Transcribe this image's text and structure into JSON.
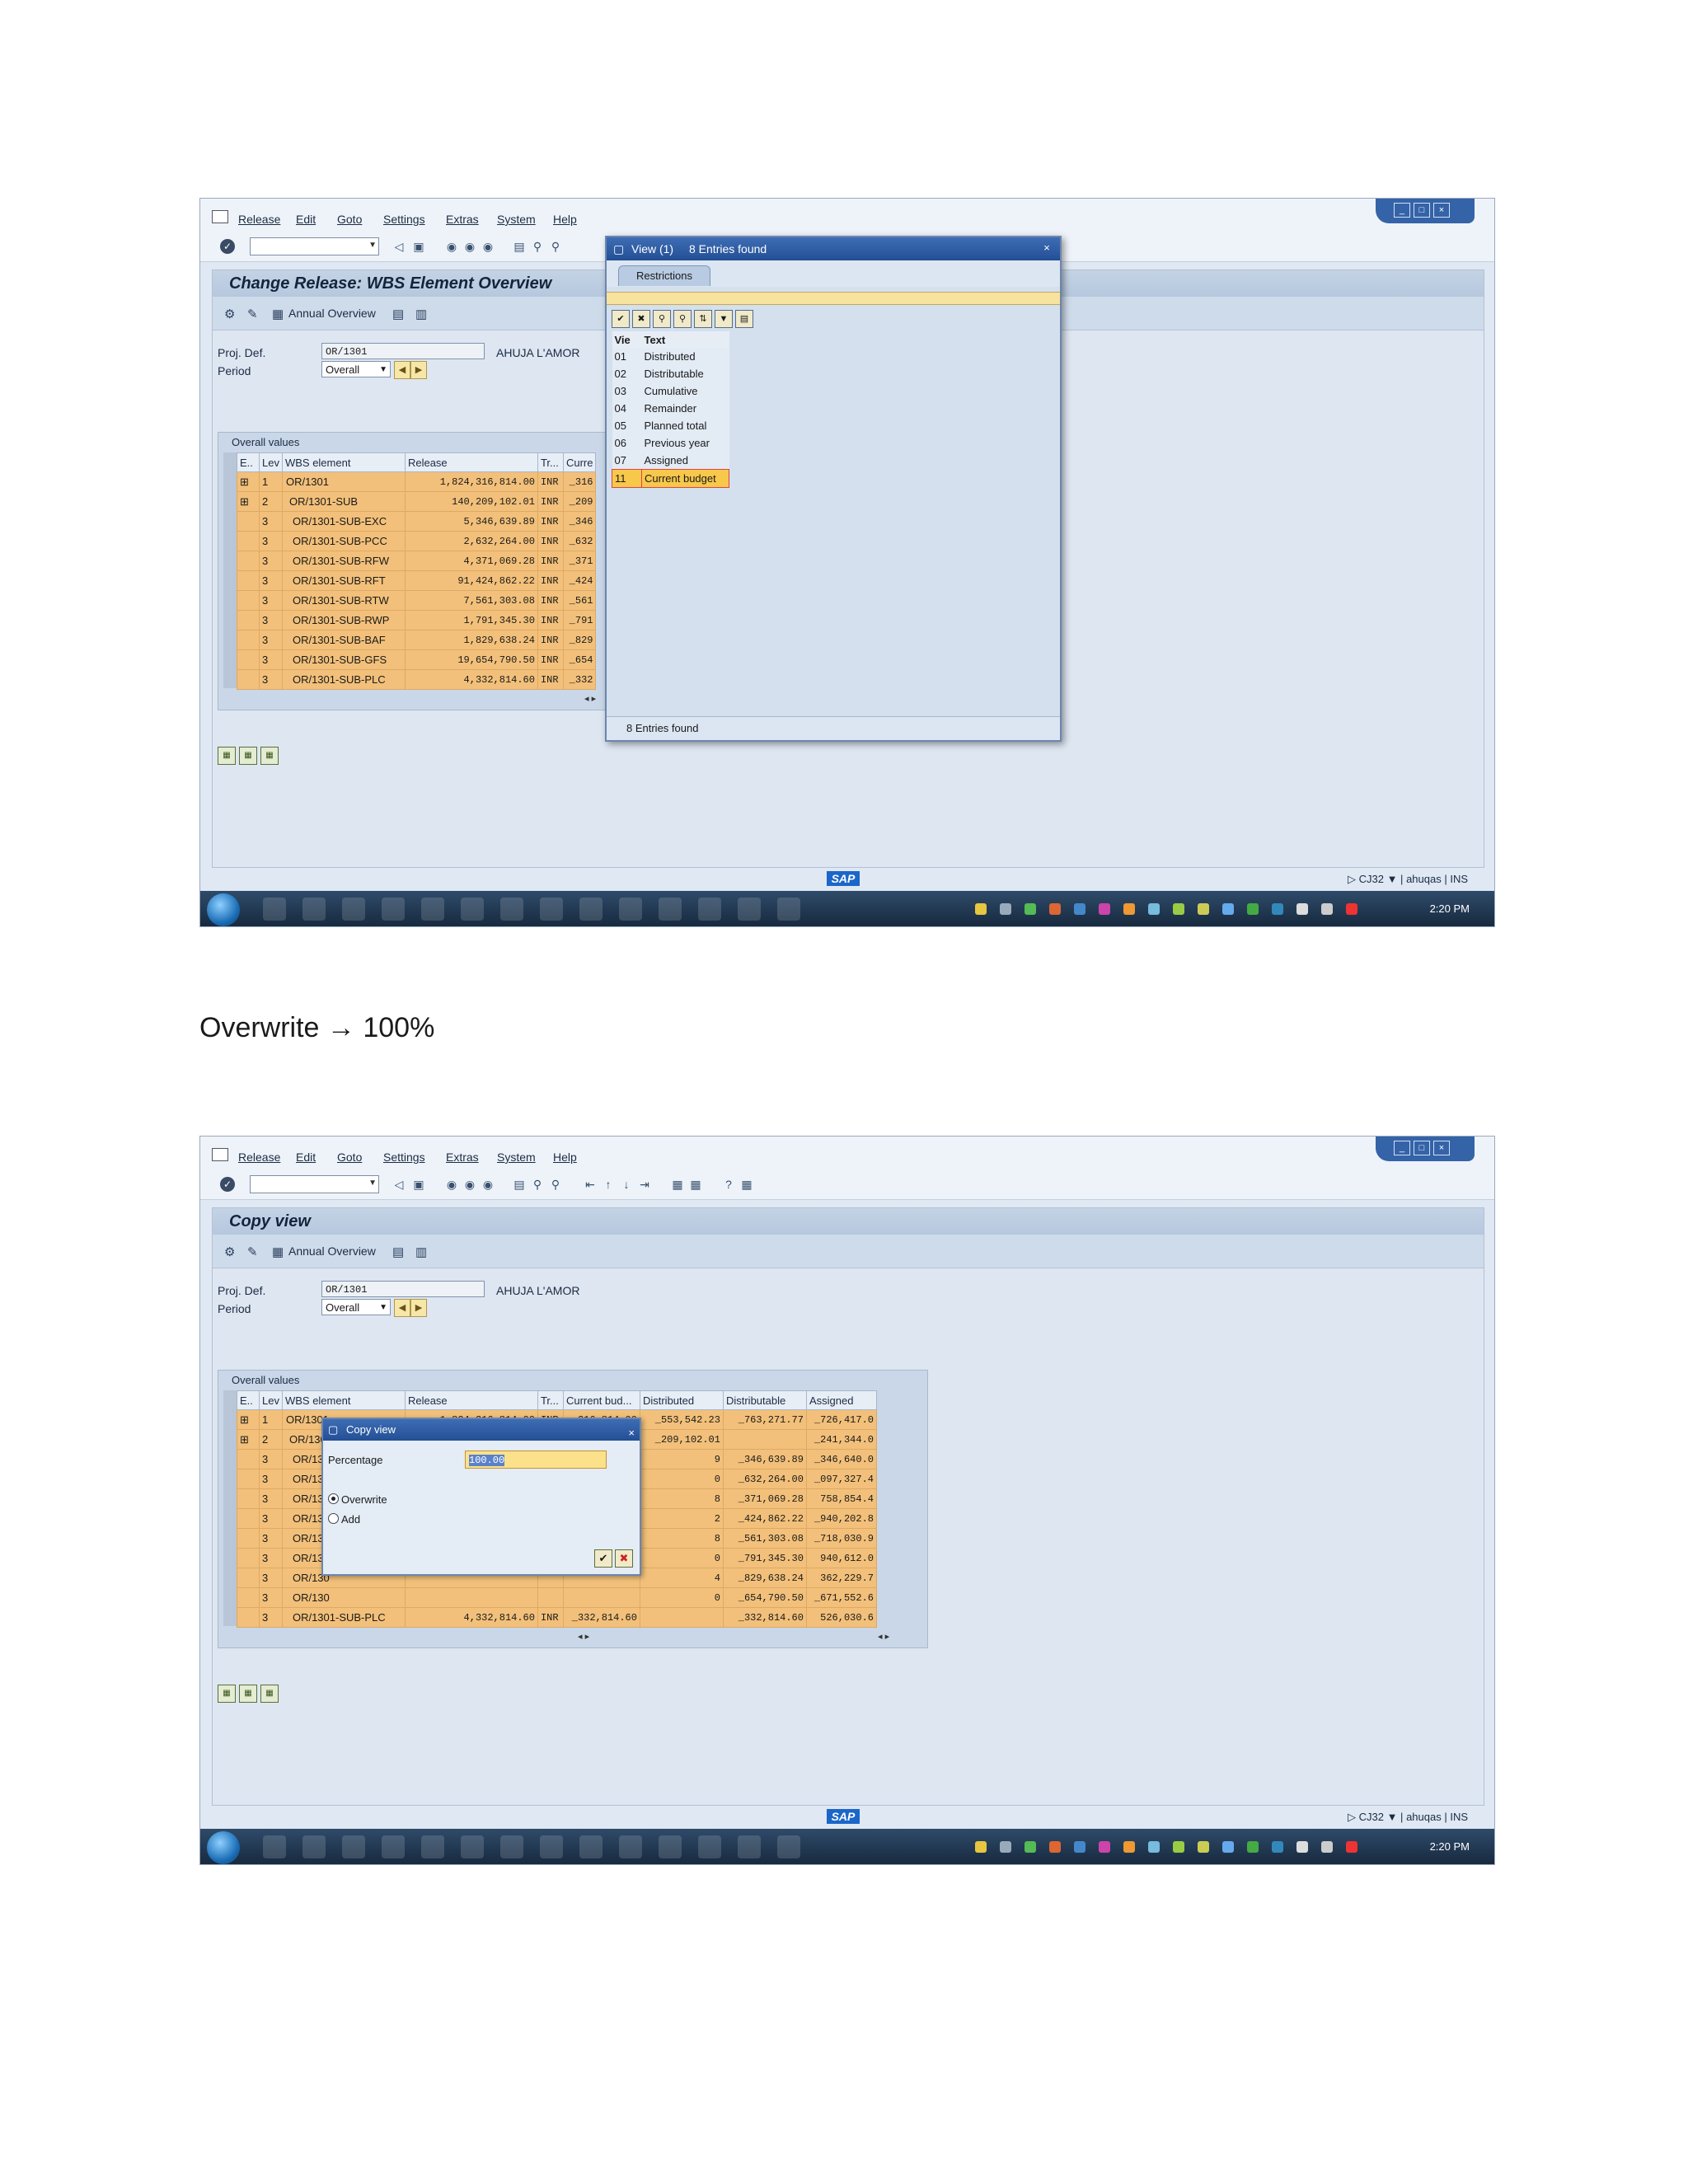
{
  "menu": [
    "Release",
    "Edit",
    "Goto",
    "Settings",
    "Extras",
    "System",
    "Help"
  ],
  "icons": {
    "window": "window-icon",
    "enter": "enter-icon",
    "save": "save-icon",
    "back": "back-icon",
    "exit": "exit-icon",
    "cancel": "cancel-icon",
    "print": "print-icon",
    "find": "find-icon",
    "help": "help-icon"
  },
  "screen1": {
    "title": "Change Release: WBS Element Overview",
    "annual_label": "Annual Overview",
    "proj_def_label": "Proj. Def.",
    "proj_def_value": "OR/1301",
    "proj_desc": "AHUJA  L'AMOR",
    "period_label": "Period",
    "period_value": "Overall",
    "group_title": "Overall values",
    "columns": [
      "E..",
      "Lev",
      "WBS element",
      "Release",
      "Tr...",
      "Curre"
    ],
    "rows": [
      {
        "lev": "1",
        "wbs": "OR/1301",
        "release": "1,824,316,814.00",
        "tr": "INR",
        "cur": "_316"
      },
      {
        "lev": "2",
        "wbs": "OR/1301-SUB",
        "release": "140,209,102.01",
        "tr": "INR",
        "cur": "_209"
      },
      {
        "lev": "3",
        "wbs": "OR/1301-SUB-EXC",
        "release": "5,346,639.89",
        "tr": "INR",
        "cur": "_346"
      },
      {
        "lev": "3",
        "wbs": "OR/1301-SUB-PCC",
        "release": "2,632,264.00",
        "tr": "INR",
        "cur": "_632"
      },
      {
        "lev": "3",
        "wbs": "OR/1301-SUB-RFW",
        "release": "4,371,069.28",
        "tr": "INR",
        "cur": "_371"
      },
      {
        "lev": "3",
        "wbs": "OR/1301-SUB-RFT",
        "release": "91,424,862.22",
        "tr": "INR",
        "cur": "_424"
      },
      {
        "lev": "3",
        "wbs": "OR/1301-SUB-RTW",
        "release": "7,561,303.08",
        "tr": "INR",
        "cur": "_561"
      },
      {
        "lev": "3",
        "wbs": "OR/1301-SUB-RWP",
        "release": "1,791,345.30",
        "tr": "INR",
        "cur": "_791"
      },
      {
        "lev": "3",
        "wbs": "OR/1301-SUB-BAF",
        "release": "1,829,638.24",
        "tr": "INR",
        "cur": "_829"
      },
      {
        "lev": "3",
        "wbs": "OR/1301-SUB-GFS",
        "release": "19,654,790.50",
        "tr": "INR",
        "cur": "_654"
      },
      {
        "lev": "3",
        "wbs": "OR/1301-SUB-PLC",
        "release": "4,332,814.60",
        "tr": "INR",
        "cur": "_332"
      }
    ],
    "popup": {
      "title": "View (1)",
      "entries": "8 Entries found",
      "tab": "Restrictions",
      "col_vie": "Vie",
      "col_text": "Text",
      "items": [
        {
          "code": "01",
          "text": "Distributed"
        },
        {
          "code": "02",
          "text": "Distributable"
        },
        {
          "code": "03",
          "text": "Cumulative"
        },
        {
          "code": "04",
          "text": "Remainder"
        },
        {
          "code": "05",
          "text": "Planned total"
        },
        {
          "code": "06",
          "text": "Previous year"
        },
        {
          "code": "07",
          "text": "Assigned"
        },
        {
          "code": "11",
          "text": "Current budget"
        }
      ],
      "status": "8 Entries found"
    }
  },
  "caption": "Overwrite → 100%",
  "screen2": {
    "title": "Copy view",
    "annual_label": "Annual Overview",
    "proj_def_label": "Proj. Def.",
    "proj_def_value": "OR/1301",
    "proj_desc": "AHUJA  L'AMOR",
    "period_label": "Period",
    "period_value": "Overall",
    "group_title": "Overall values",
    "columns": [
      "E..",
      "Lev",
      "WBS element",
      "Release",
      "Tr...",
      "Current bud...",
      "Distributed",
      "Distributable",
      "Assigned"
    ],
    "rows": [
      {
        "lev": "1",
        "wbs": "OR/1301",
        "release": "1,824,316,814.00",
        "tr": "INR",
        "cur": "_316,814.00",
        "dist": "_553,542.23",
        "dable": "_763,271.77",
        "asg": "_726,417.0"
      },
      {
        "lev": "2",
        "wbs": "OR/1301-SUB",
        "release": "140,209,102.01",
        "tr": "INR",
        "cur": "_209,102.01",
        "dist": "_209,102.01",
        "dable": "",
        "asg": "_241,344.0"
      },
      {
        "lev": "3",
        "wbs": "OR/130",
        "release": "",
        "tr": "",
        "cur": "",
        "dist": "9",
        "dable": "_346,639.89",
        "asg": "_346,640.0"
      },
      {
        "lev": "3",
        "wbs": "OR/130",
        "release": "",
        "tr": "",
        "cur": "",
        "dist": "0",
        "dable": "_632,264.00",
        "asg": "_097,327.4"
      },
      {
        "lev": "3",
        "wbs": "OR/130",
        "release": "",
        "tr": "",
        "cur": "",
        "dist": "8",
        "dable": "_371,069.28",
        "asg": "758,854.4"
      },
      {
        "lev": "3",
        "wbs": "OR/130",
        "release": "",
        "tr": "",
        "cur": "",
        "dist": "2",
        "dable": "_424,862.22",
        "asg": "_940,202.8"
      },
      {
        "lev": "3",
        "wbs": "OR/130",
        "release": "",
        "tr": "",
        "cur": "",
        "dist": "8",
        "dable": "_561,303.08",
        "asg": "_718,030.9"
      },
      {
        "lev": "3",
        "wbs": "OR/130",
        "release": "",
        "tr": "",
        "cur": "",
        "dist": "0",
        "dable": "_791,345.30",
        "asg": "940,612.0"
      },
      {
        "lev": "3",
        "wbs": "OR/130",
        "release": "",
        "tr": "",
        "cur": "",
        "dist": "4",
        "dable": "_829,638.24",
        "asg": "362,229.7"
      },
      {
        "lev": "3",
        "wbs": "OR/130",
        "release": "",
        "tr": "",
        "cur": "",
        "dist": "0",
        "dable": "_654,790.50",
        "asg": "_671,552.6"
      },
      {
        "lev": "3",
        "wbs": "OR/1301-SUB-PLC",
        "release": "4,332,814.60",
        "tr": "INR",
        "cur": "_332,814.60",
        "dist": "",
        "dable": "_332,814.60",
        "asg": "526,030.6"
      }
    ],
    "dialog": {
      "title": "Copy view",
      "percentage_label": "Percentage",
      "percentage_value": "100.00",
      "overwrite_label": "Overwrite",
      "add_label": "Add"
    }
  },
  "status": {
    "tcode": "CJ32",
    "user": "ahuqas",
    "mode": "INS",
    "sap": "SAP"
  },
  "taskbar": {
    "clock": "2:20 PM"
  }
}
